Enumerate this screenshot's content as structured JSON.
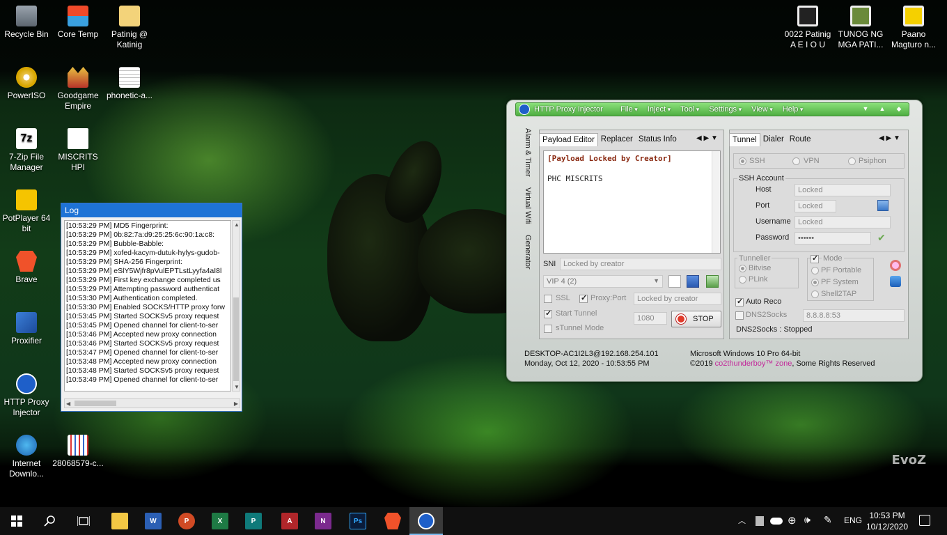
{
  "desktop": {
    "icons": [
      {
        "label": "Recycle Bin"
      },
      {
        "label": "Core Temp"
      },
      {
        "label": "Patinig @ Katinig"
      },
      {
        "label": "PowerISO"
      },
      {
        "label": "Goodgame Empire"
      },
      {
        "label": "phonetic-a..."
      },
      {
        "label": "7-Zip File Manager"
      },
      {
        "label": "MISCRITS HPI"
      },
      {
        "label": "PotPlayer 64 bit"
      },
      {
        "label": "Brave"
      },
      {
        "label": "Proxifier"
      },
      {
        "label": "HTTP Proxy Injector"
      },
      {
        "label": "Internet Downlo..."
      },
      {
        "label": "28068579-c..."
      },
      {
        "label": "0022 Patinig A E I O U"
      },
      {
        "label": "TUNOG NG MGA PATI..."
      },
      {
        "label": "Paano Magturo n..."
      }
    ],
    "watermark": "EvoZ"
  },
  "log_window": {
    "title": "Log",
    "lines": [
      "[10:53:29 PM] MD5 Fingerprint:",
      "[10:53:29 PM] 0b:82:7a:d9:25:25:6c:90:1a:c8:",
      "[10:53:29 PM] Bubble-Babble:",
      "[10:53:29 PM] xofed-kacym-dutuk-hylys-gudob-",
      "[10:53:29 PM] SHA-256 Fingerprint:",
      "[10:53:29 PM] eSlY5Wjfr8pVulEPTLstLyyfa4aI8l",
      "[10:53:29 PM] First key exchange completed us",
      "[10:53:29 PM] Attempting password authenticat",
      "[10:53:30 PM] Authentication completed.",
      "[10:53:30 PM] Enabled SOCKS/HTTP proxy forw",
      "[10:53:45 PM] Started SOCKSv5 proxy request",
      "[10:53:45 PM] Opened channel for client-to-ser",
      "[10:53:46 PM] Accepted new proxy connection",
      "[10:53:46 PM] Started SOCKSv5 proxy request",
      "[10:53:47 PM] Opened channel for client-to-ser",
      "[10:53:48 PM] Accepted new proxy connection",
      "[10:53:48 PM] Started SOCKSv5 proxy request",
      "[10:53:49 PM] Opened channel for client-to-ser"
    ]
  },
  "hpi": {
    "title": "HTTP Proxy Injector",
    "menu": [
      "File",
      "Inject",
      "Tool",
      "Settings",
      "View",
      "Help"
    ],
    "vtabs": [
      "Alarm & Timer",
      "Virtual Wifi",
      "Generator"
    ],
    "left_tabs": [
      "Payload Editor",
      "Replacer",
      "Status Info"
    ],
    "payload_line1": "[Payload Locked by Creator]",
    "payload_line2": "PHC MISCRITS",
    "sni_label": "SNI",
    "sni_value": "Locked by creator",
    "server_select": "VIP 4 (2)",
    "ssl_label": "SSL",
    "proxy_port_label": "Proxy:Port",
    "proxy_port_value": "Locked by creator",
    "start_tunnel_label": "Start Tunnel",
    "local_port": "1080",
    "stop_label": "STOP",
    "stunnel_label": "sTunnel Mode",
    "right_tabs": [
      "Tunnel",
      "Dialer",
      "Route"
    ],
    "protocols": [
      "SSH",
      "VPN",
      "Psiphon"
    ],
    "ssh_account_label": "SSH Account",
    "host_label": "Host",
    "host_value": "Locked",
    "port_label": "Port",
    "port_value": "Locked",
    "username_label": "Username",
    "username_value": "Locked",
    "password_label": "Password",
    "password_value": "••••••",
    "tunnelier_label": "Tunnelier",
    "tunnelier_options": [
      "Bitvise",
      "PLink"
    ],
    "mode_label": "Mode",
    "mode_options": [
      "PF Portable",
      "PF System",
      "Shell2TAP"
    ],
    "auto_reco_label": "Auto Reco",
    "dns2socks_label": "DNS2Socks",
    "dns_value": "8.8.8.8:53",
    "dns_status": "DNS2Socks : Stopped",
    "status_host": "DESKTOP-AC1I2L3@192.168.254.101",
    "status_datetime": "Monday, Oct 12, 2020 - 10:53:55 PM",
    "status_os": "Microsoft Windows 10 Pro 64-bit",
    "copyright_prefix": "©2019",
    "copyright_brand": "co2thunderboy™ zone",
    "copyright_suffix": ", Some Rights Reserved",
    "colors": {
      "accent_green": "#4fae42",
      "brand_pink": "#c2289a"
    }
  },
  "taskbar": {
    "apps": [
      "ps-label"
    ],
    "ps_label": "Ps",
    "language": "ENG",
    "time": "10:53 PM",
    "date": "10/12/2020"
  }
}
